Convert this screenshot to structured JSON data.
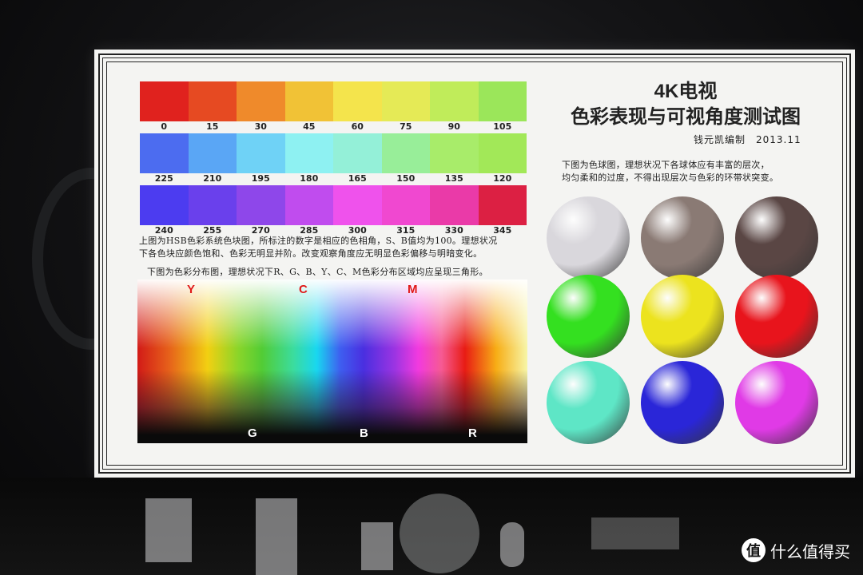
{
  "hue_rows": [
    {
      "colors": [
        "#e0221e",
        "#e64a22",
        "#ef8a2b",
        "#f1c236",
        "#f4e44c",
        "#e5ea56",
        "#c0ec5a",
        "#9be65a"
      ],
      "labels": [
        "0",
        "15",
        "30",
        "45",
        "60",
        "75",
        "90",
        "105"
      ]
    },
    {
      "colors": [
        "#4c6cf0",
        "#5aa6f5",
        "#6fd2f6",
        "#8ef1f2",
        "#94f0d8",
        "#98ee99",
        "#a8ec6a",
        "#a2e858"
      ],
      "labels": [
        "225",
        "210",
        "195",
        "180",
        "165",
        "150",
        "135",
        "120"
      ]
    },
    {
      "colors": [
        "#4c3cf0",
        "#6a40ec",
        "#8e47ea",
        "#c04cee",
        "#ef52ec",
        "#f048d0",
        "#ea3aa8",
        "#dc2043"
      ],
      "labels": [
        "240",
        "255",
        "270",
        "285",
        "300",
        "315",
        "330",
        "345"
      ]
    }
  ],
  "text": {
    "hsb_note_1": "上图为HSB色彩系统色块图，所标注的数字是相应的色相角，S、B值均为100。理想状况",
    "hsb_note_2": "下各色块应颜色饱和、色彩无明显并阶。改变观察角度应无明显色彩偏移与明暗变化。",
    "dist_note": "下图为色彩分布图，理想状况下R、G、B、Y、C、M色彩分布区域均应呈现三角形。",
    "title_1": "4K电视",
    "title_2": "色彩表现与可视角度测试图",
    "author": "钱元凯编制　2013.11",
    "sphere_note_1": "下图为色球图，理想状况下各球体应有丰富的层次，",
    "sphere_note_2": "均匀柔和的过度，不得出现层次与色彩的环带状突变。"
  },
  "distribution": {
    "top_labels": [
      "Y",
      "C",
      "M"
    ],
    "bottom_labels": [
      "G",
      "B",
      "R"
    ]
  },
  "spheres": [
    {
      "name": "white",
      "color": "#d9d7dc"
    },
    {
      "name": "light-brown",
      "color": "#8a7a74"
    },
    {
      "name": "dark-brown",
      "color": "#5a4644"
    },
    {
      "name": "green",
      "color": "#34e020"
    },
    {
      "name": "yellow",
      "color": "#ece31e"
    },
    {
      "name": "red",
      "color": "#e8141c"
    },
    {
      "name": "cyan",
      "color": "#5ee6c6"
    },
    {
      "name": "blue",
      "color": "#2a26d8"
    },
    {
      "name": "magenta",
      "color": "#e03ae6"
    }
  ],
  "watermark": {
    "logo": "值",
    "text": "什么值得买"
  }
}
